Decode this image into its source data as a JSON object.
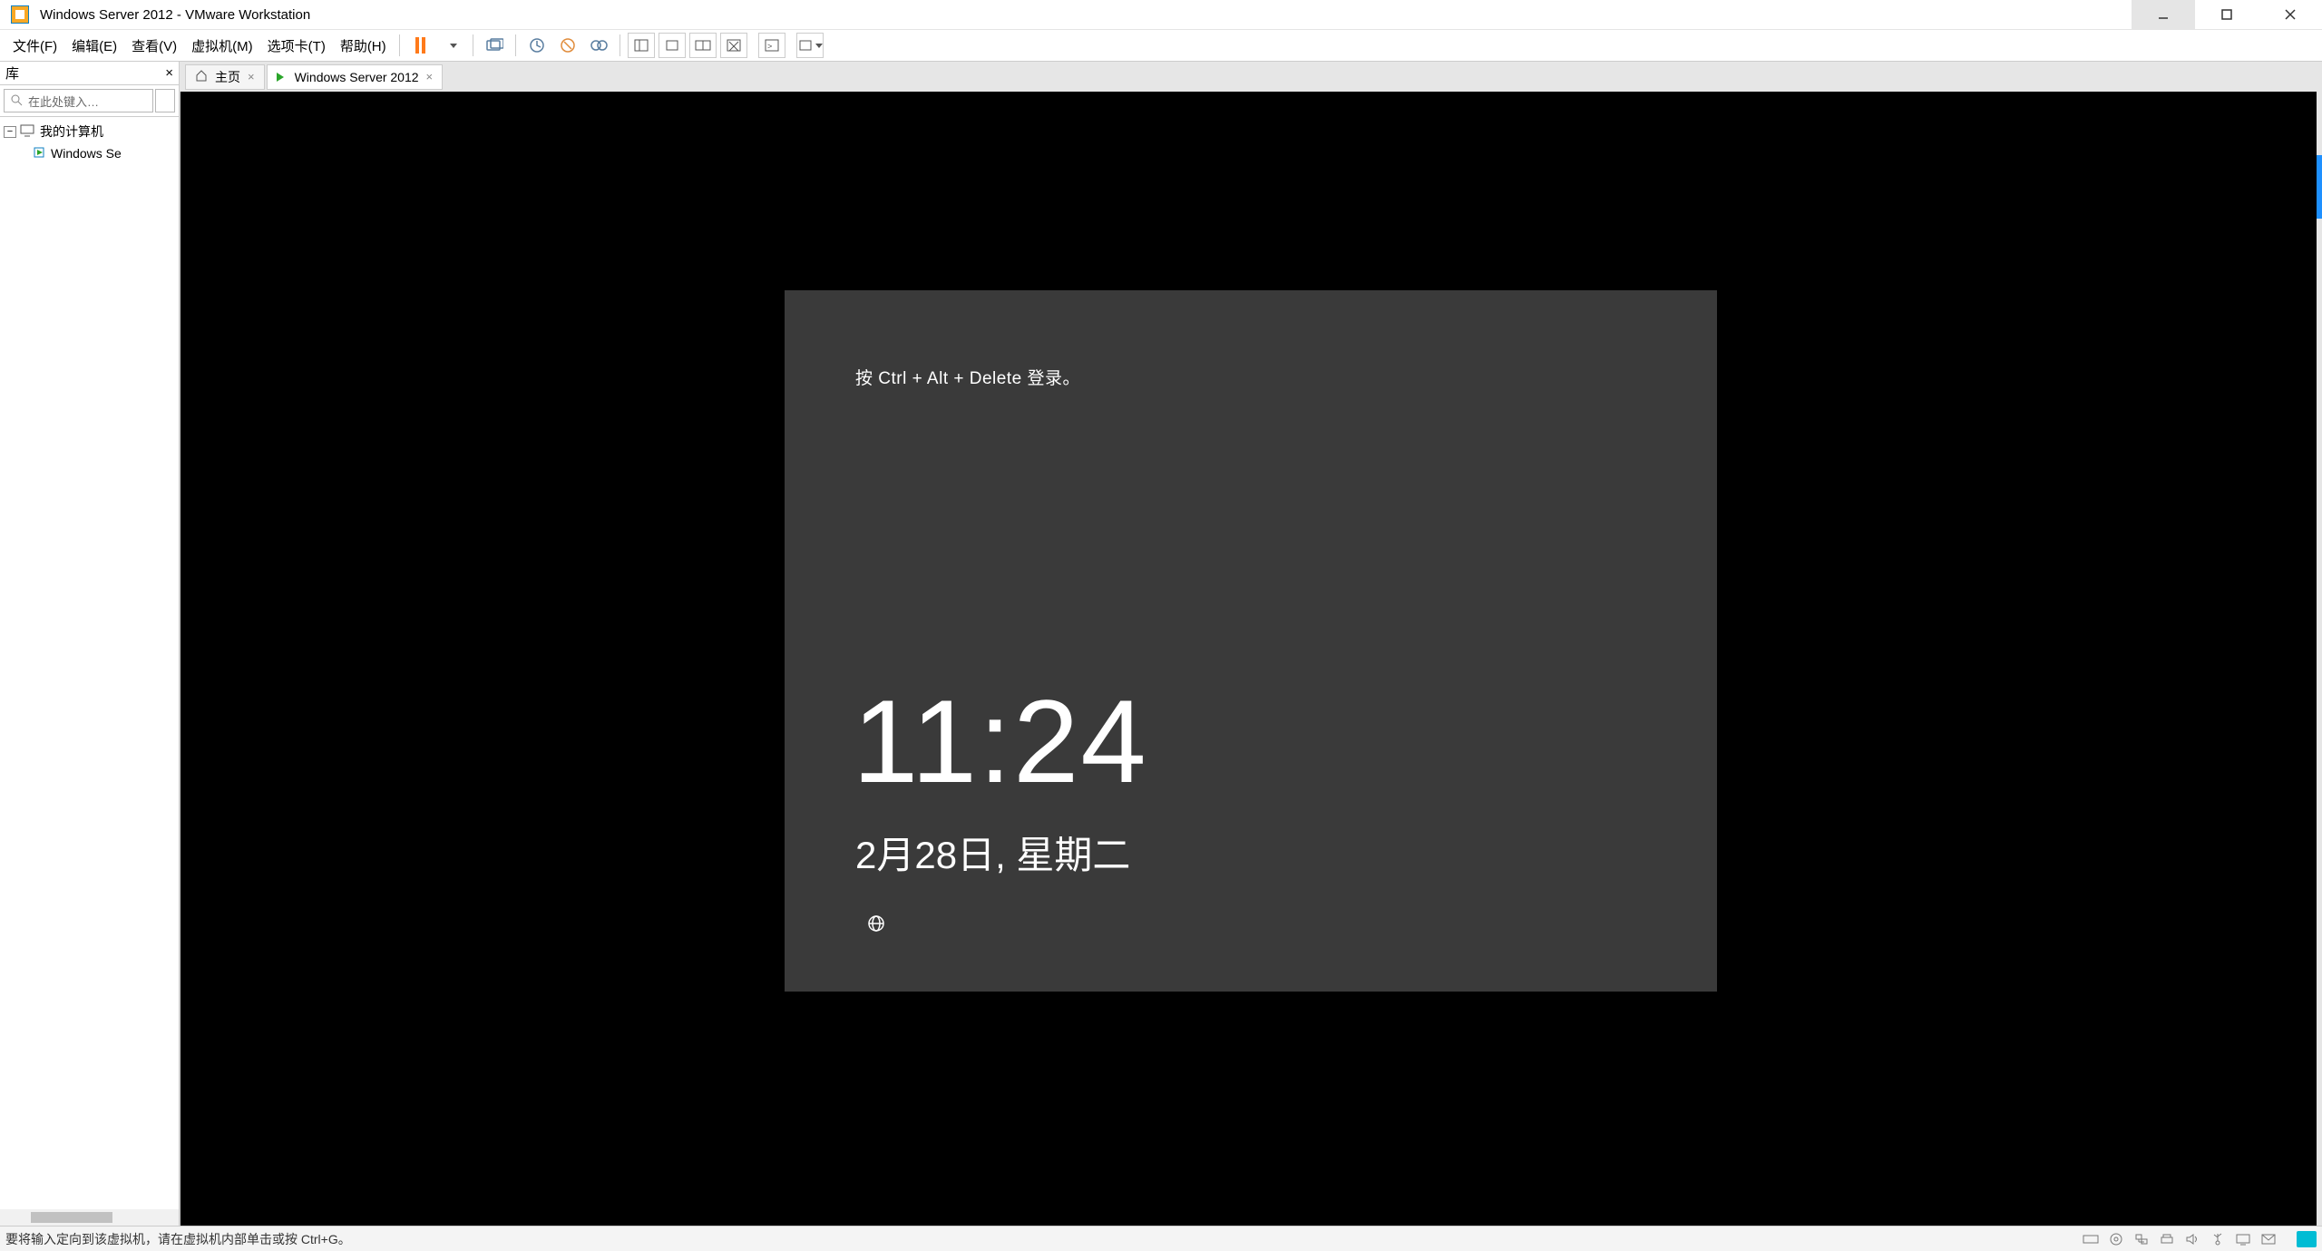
{
  "window": {
    "title": "Windows Server 2012 - VMware Workstation"
  },
  "menu": {
    "file": "文件(F)",
    "edit": "编辑(E)",
    "view": "查看(V)",
    "vm": "虚拟机(M)",
    "tabs": "选项卡(T)",
    "help": "帮助(H)"
  },
  "sidebar": {
    "title": "库",
    "search_placeholder": "在此处键入…",
    "root": "我的计算机",
    "child": "Windows Se"
  },
  "tabs": {
    "home": "主页",
    "vm": "Windows Server 2012"
  },
  "lockscreen": {
    "prompt": "按 Ctrl + Alt + Delete 登录。",
    "time": "11:24",
    "date": "2月28日, 星期二"
  },
  "statusbar": {
    "msg": "要将输入定向到该虚拟机，请在虚拟机内部单击或按 Ctrl+G。"
  }
}
